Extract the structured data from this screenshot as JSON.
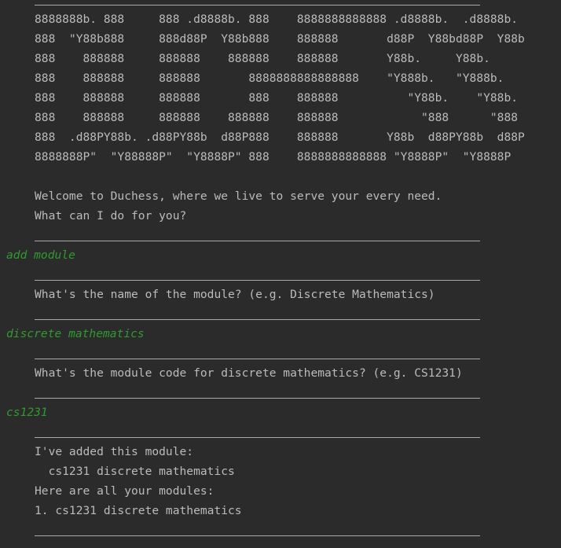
{
  "banner": [
    "8888888b. 888     888 .d8888b. 888    8888888888888 .d8888b.  .d8888b.",
    "888  \"Y88b888     888d88P  Y88b888    888888       d88P  Y88bd88P  Y88b",
    "888    888888     888888    888888    888888       Y88b.     Y88b.",
    "888    888888     888888       8888888888888888    \"Y888b.   \"Y888b.",
    "888    888888     888888       888    888888          \"Y88b.    \"Y88b.",
    "888    888888     888888    888888    888888            \"888      \"888",
    "888  .d88PY88b. .d88PY88b  d88P888    888888       Y88b  d88PY88b  d88P",
    "8888888P\"  \"Y88888P\"  \"Y8888P\" 888    8888888888888 \"Y8888P\"  \"Y8888P"
  ],
  "greeting": {
    "line1": "Welcome to Duchess, where we live to serve your every need.",
    "line2": "What can I do for you?"
  },
  "exchanges": [
    {
      "input": "add module",
      "output": [
        "What's the name of the module? (e.g. Discrete Mathematics)"
      ]
    },
    {
      "input": "discrete mathematics",
      "output": [
        "What's the module code for discrete mathematics? (e.g. CS1231)"
      ]
    },
    {
      "input": "cs1231",
      "output": [
        "I've added this module:",
        "  cs1231 discrete mathematics",
        "Here are all your modules:",
        "1. cs1231 discrete mathematics"
      ]
    }
  ]
}
